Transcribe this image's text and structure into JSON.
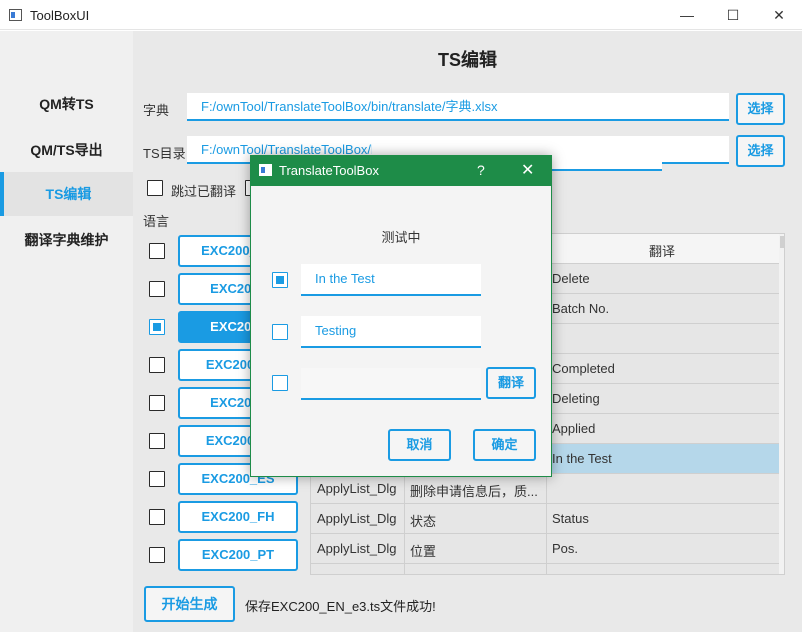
{
  "window": {
    "title": "ToolBoxUI",
    "min_glyph": "—",
    "max_glyph": "☐",
    "close_glyph": "✕"
  },
  "sidebar": {
    "items": [
      {
        "label": "QM转TS"
      },
      {
        "label": "QM/TS导出"
      },
      {
        "label": "TS编辑"
      },
      {
        "label": "翻译字典维护"
      }
    ],
    "active_index": 2
  },
  "page": {
    "title": "TS编辑",
    "dict_label": "字典",
    "dict_path": "F:/ownTool/TranslateToolBox/bin/translate/字典.xlsx",
    "ts_dir_label": "TS目录",
    "ts_dir_path": "F:/ownTool/TranslateToolBox/bin/translate",
    "browse_label": "选择",
    "skip_translated_label": "跳过已翻译",
    "language_label": "语言",
    "generate_button": "开始生成",
    "status_message": "保存EXC200_EN_e3.ts文件成功!"
  },
  "languages": [
    {
      "label": "EXC200_EN",
      "checked": false
    },
    {
      "label": "EXC200_",
      "checked": false
    },
    {
      "label": "EXC200_",
      "checked": true,
      "active": true
    },
    {
      "label": "EXC200_E",
      "checked": false
    },
    {
      "label": "EXC200_",
      "checked": false
    },
    {
      "label": "EXC200_E",
      "checked": false
    },
    {
      "label": "EXC200_ES",
      "checked": false
    },
    {
      "label": "EXC200_FH",
      "checked": false
    },
    {
      "label": "EXC200_PT",
      "checked": false
    }
  ],
  "table": {
    "headers": [
      "",
      "",
      "翻译"
    ],
    "rows": [
      {
        "context": "",
        "source": "",
        "translation": "Delete"
      },
      {
        "context": "",
        "source": "",
        "translation": "Batch No."
      },
      {
        "context": "",
        "source": "",
        "translation": ""
      },
      {
        "context": "",
        "source": "",
        "translation": "Completed"
      },
      {
        "context": "",
        "source": "",
        "translation": "Deleting"
      },
      {
        "context": "",
        "source": "",
        "translation": "Applied"
      },
      {
        "context": "",
        "source": "",
        "translation": "In the Test",
        "selected": true
      },
      {
        "context": "ApplyList_Dlg",
        "source": "删除申请信息后，质...",
        "translation": ""
      },
      {
        "context": "ApplyList_Dlg",
        "source": "状态",
        "translation": "Status"
      },
      {
        "context": "ApplyList_Dlg",
        "source": "位置",
        "translation": "Pos."
      },
      {
        "context": "",
        "source": "",
        "translation": ""
      }
    ]
  },
  "dialog": {
    "title": "TranslateToolBox",
    "help_glyph": "?",
    "close_glyph": "✕",
    "source_text": "测试中",
    "options": [
      {
        "value": "In the Test",
        "checked": true
      },
      {
        "value": "Testing",
        "checked": false
      },
      {
        "value": "",
        "checked": false
      }
    ],
    "translate_button": "翻译",
    "cancel_button": "取消",
    "ok_button": "确定"
  },
  "colors": {
    "accent": "#1a9be3",
    "dialog_title_bg": "#1e8c48",
    "selected_row": "#b5d7ea"
  }
}
